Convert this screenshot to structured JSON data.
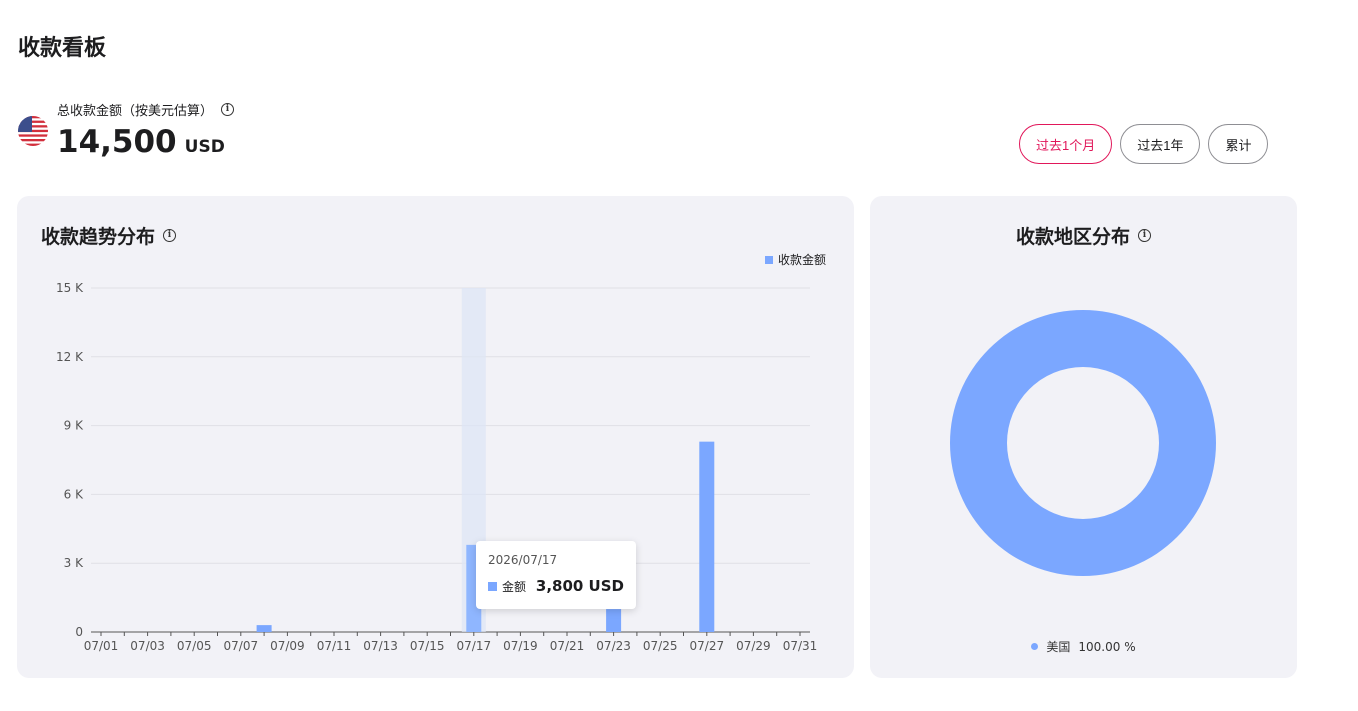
{
  "page": {
    "title": "收款看板"
  },
  "summary": {
    "label": "总收款金额（按美元估算）",
    "amount": "14,500",
    "currency": "USD",
    "flag_icon": "us-flag-icon"
  },
  "range_buttons": [
    {
      "label": "过去1个月",
      "active": true
    },
    {
      "label": "过去1年",
      "active": false
    },
    {
      "label": "累计",
      "active": false
    }
  ],
  "colors": {
    "accent": "#e1175a",
    "series": "#7ba7ff",
    "highlight": "#dde6f5"
  },
  "trend": {
    "title": "收款趋势分布",
    "legend": "收款金额",
    "tooltip": {
      "date": "2026/07/17",
      "series": "金额",
      "value": "3,800 USD"
    }
  },
  "region": {
    "title": "收款地区分布",
    "legend": [
      {
        "name": "美国",
        "percent": "100.00 %"
      }
    ]
  },
  "chart_data": [
    {
      "type": "bar",
      "title": "收款趋势分布",
      "xlabel": "",
      "ylabel": "",
      "ylim": [
        0,
        15000
      ],
      "yticks": [
        "0",
        "3 K",
        "6 K",
        "9 K",
        "12 K",
        "15 K"
      ],
      "yticks_values": [
        0,
        3000,
        6000,
        9000,
        12000,
        15000
      ],
      "categories": [
        "07/01",
        "07/02",
        "07/03",
        "07/04",
        "07/05",
        "07/06",
        "07/07",
        "07/08",
        "07/09",
        "07/10",
        "07/11",
        "07/12",
        "07/13",
        "07/14",
        "07/15",
        "07/16",
        "07/17",
        "07/18",
        "07/19",
        "07/20",
        "07/21",
        "07/22",
        "07/23",
        "07/24",
        "07/25",
        "07/26",
        "07/27",
        "07/28",
        "07/29",
        "07/30",
        "07/31"
      ],
      "xtick_labels": [
        "07/01",
        "07/03",
        "07/05",
        "07/07",
        "07/09",
        "07/11",
        "07/13",
        "07/15",
        "07/17",
        "07/19",
        "07/21",
        "07/23",
        "07/25",
        "07/27",
        "07/29",
        "07/31"
      ],
      "series": [
        {
          "name": "收款金额",
          "values": [
            0,
            0,
            0,
            0,
            0,
            0,
            0,
            300,
            0,
            0,
            0,
            0,
            0,
            0,
            0,
            0,
            3800,
            0,
            0,
            0,
            0,
            0,
            1000,
            0,
            0,
            0,
            8300,
            0,
            0,
            0,
            0
          ]
        }
      ],
      "highlight_category": "07/17",
      "legend": "top-right",
      "grid": true
    },
    {
      "type": "pie",
      "title": "收款地区分布",
      "donut": true,
      "slices": [
        {
          "label": "美国",
          "value": 100.0
        }
      ],
      "legend": "bottom"
    }
  ]
}
